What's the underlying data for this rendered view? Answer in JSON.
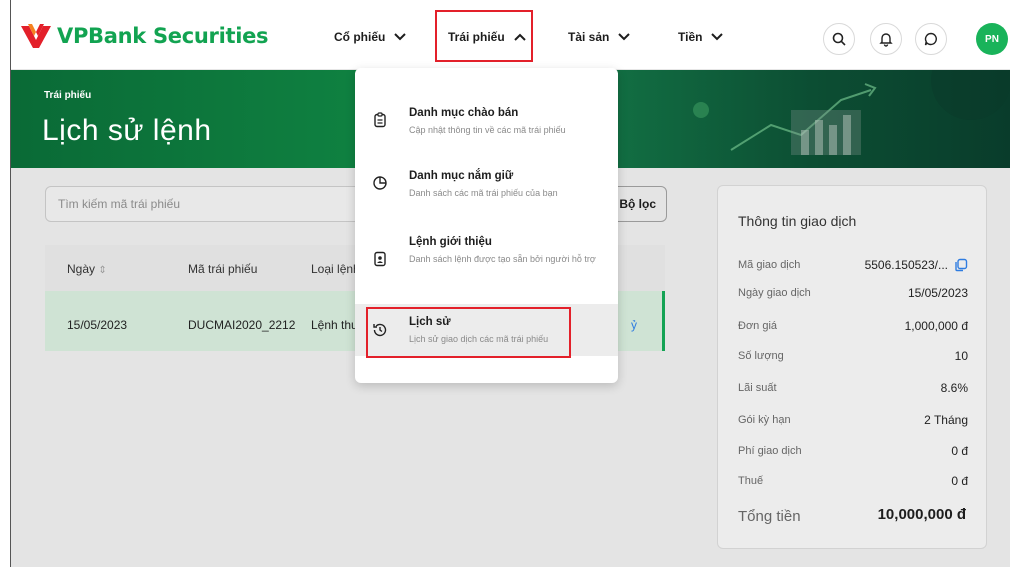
{
  "header": {
    "brand": "VPBank Securities",
    "nav": [
      {
        "label": "Cổ phiếu",
        "icon": "chevron-down-icon"
      },
      {
        "label": "Trái phiếu",
        "icon": "chevron-up-icon"
      },
      {
        "label": "Tài sản",
        "icon": "chevron-down-icon"
      },
      {
        "label": "Tiền",
        "icon": "chevron-down-icon"
      }
    ],
    "icons": [
      "search-icon",
      "bell-icon",
      "chat-icon"
    ],
    "avatar": "PN"
  },
  "banner": {
    "breadcrumb": "Trái phiếu",
    "title": "Lịch sử lệnh"
  },
  "search": {
    "placeholder": "Tìm kiếm mã trái phiếu"
  },
  "filter": {
    "label": "Bộ lọc"
  },
  "table": {
    "headers": [
      "Ngày",
      "Mã trái phiếu",
      "Loại lệnh"
    ],
    "rows": [
      {
        "date": "15/05/2023",
        "code": "DUCMAI2020_2212",
        "type": "Lệnh thuế",
        "status": "ỷ"
      }
    ]
  },
  "dropdown": {
    "items": [
      {
        "title": "Danh mục chào bán",
        "desc": "Cập nhật thông tin về các mã trái phiếu",
        "icon": "clipboard-icon"
      },
      {
        "title": "Danh mục nắm giữ",
        "desc": "Danh sách các mã trái phiếu của bạn",
        "icon": "pie-chart-icon"
      },
      {
        "title": "Lệnh giới thiệu",
        "desc": "Danh sách lệnh được tạo sẵn bởi người hỗ trợ",
        "icon": "document-user-icon"
      },
      {
        "title": "Lịch sử",
        "desc": "Lịch sử giao dịch các mã trái phiếu",
        "icon": "history-icon"
      }
    ]
  },
  "info_panel": {
    "title": "Thông tin giao dịch",
    "rows": [
      {
        "label": "Mã giao dịch",
        "value": "5506.150523/..."
      },
      {
        "label": "Ngày giao dịch",
        "value": "15/05/2023"
      },
      {
        "label": "Đơn giá",
        "value": "1,000,000 đ"
      },
      {
        "label": "Số lượng",
        "value": "10"
      },
      {
        "label": "Lãi suất",
        "value": "8.6%"
      },
      {
        "label": "Gói kỳ hạn",
        "value": "2 Tháng"
      },
      {
        "label": "Phí giao dịch",
        "value": "0 đ"
      },
      {
        "label": "Thuế",
        "value": "0 đ"
      }
    ],
    "total_label": "Tổng tiền",
    "total_value": "10,000,000 đ"
  },
  "colors": {
    "brand_green": "#12a351",
    "highlight_red": "#e3202a",
    "link_blue": "#2f7ce0"
  }
}
